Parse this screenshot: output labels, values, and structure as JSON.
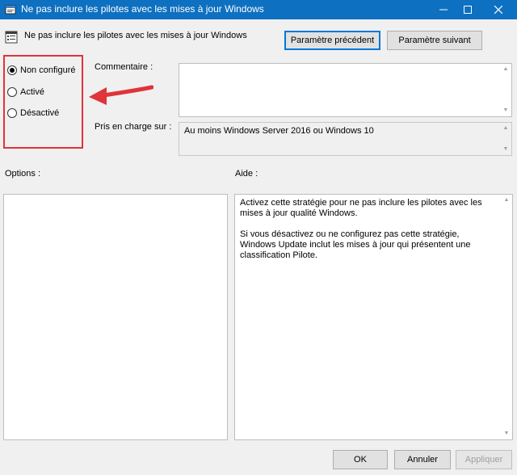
{
  "window": {
    "title": "Ne pas inclure les pilotes avec les mises à jour Windows"
  },
  "header": {
    "policy_name": "Ne pas inclure les pilotes avec les mises à jour Windows",
    "prev_button": "Paramètre précédent",
    "next_button": "Paramètre suivant"
  },
  "state": {
    "options": [
      {
        "label": "Non configuré",
        "selected": true
      },
      {
        "label": "Activé",
        "selected": false
      },
      {
        "label": "Désactivé",
        "selected": false
      }
    ]
  },
  "comment": {
    "label": "Commentaire :",
    "value": ""
  },
  "supported": {
    "label": "Pris en charge sur :",
    "value": "Au moins Windows Server 2016 ou Windows 10"
  },
  "options_panel": {
    "label": "Options :"
  },
  "help_panel": {
    "label": "Aide :",
    "paragraphs": [
      "Activez cette stratégie pour ne pas inclure les pilotes avec les mises à jour qualité Windows.",
      "Si vous désactivez ou ne configurez pas cette stratégie, Windows Update inclut les mises à jour qui présentent une classification Pilote."
    ]
  },
  "footer": {
    "ok_button": "OK",
    "cancel_button": "Annuler",
    "apply_button": "Appliquer"
  },
  "colors": {
    "titlebar": "#0e70c0",
    "highlight": "#e0333a",
    "accent": "#0078d7"
  }
}
